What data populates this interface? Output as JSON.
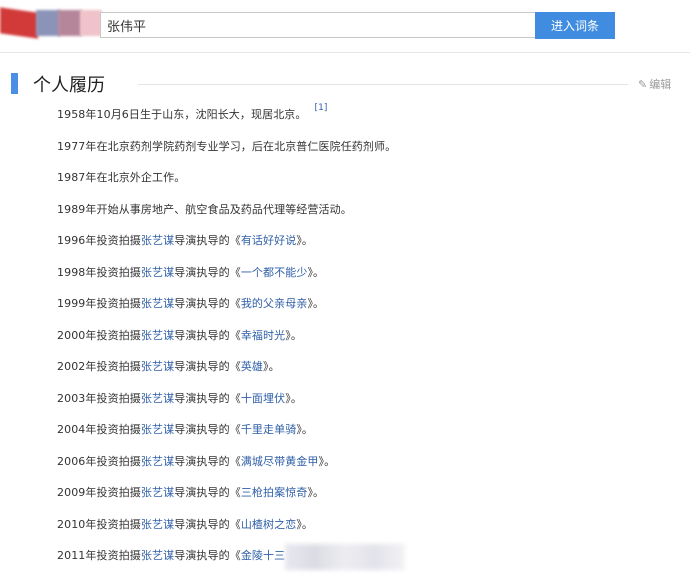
{
  "header": {
    "search_value": "张伟平",
    "search_button": "进入词条",
    "logo_colors": [
      "#d23a3a",
      "#8c93b8",
      "#b5869a",
      "#efc3c9"
    ]
  },
  "section": {
    "title": "个人履历",
    "edit_label": "编辑",
    "accent_color": "#4a8ee6"
  },
  "entries": [
    {
      "text": "1958年10月6日生于山东，沈阳长大，现居北京。",
      "ref": "[1]"
    },
    {
      "text": "1977年在北京药剂学院药剂专业学习，后在北京普仁医院任药剂师。"
    },
    {
      "text": "1987年在北京外企工作。"
    },
    {
      "text": "1989年开始从事房地产、航空食品及药品代理等经营活动。"
    },
    {
      "prefix": "1996年投资拍摄",
      "director": "张艺谋",
      "middle": "导演执导的《",
      "film": "有话好好说",
      "suffix": "》。"
    },
    {
      "prefix": "1998年投资拍摄",
      "director": "张艺谋",
      "middle": "导演执导的《",
      "film": "一个都不能少",
      "suffix": "》。"
    },
    {
      "prefix": "1999年投资拍摄",
      "director": "张艺谋",
      "middle": "导演执导的《",
      "film": "我的父亲母亲",
      "suffix": "》。"
    },
    {
      "prefix": "2000年投资拍摄",
      "director": "张艺谋",
      "middle": "导演执导的《",
      "film": "幸福时光",
      "suffix": "》。"
    },
    {
      "prefix": "2002年投资拍摄",
      "director": "张艺谋",
      "middle": "导演执导的《",
      "film": "英雄",
      "suffix": "》。"
    },
    {
      "prefix": "2003年投资拍摄",
      "director": "张艺谋",
      "middle": "导演执导的《",
      "film": "十面埋伏",
      "suffix": "》。"
    },
    {
      "prefix": "2004年投资拍摄",
      "director": "张艺谋",
      "middle": "导演执导的《",
      "film": "千里走单骑",
      "suffix": "》。"
    },
    {
      "prefix": "2006年投资拍摄",
      "director": "张艺谋",
      "middle": "导演执导的《",
      "film": "满城尽带黄金甲",
      "suffix": "》。"
    },
    {
      "prefix": "2009年投资拍摄",
      "director": "张艺谋",
      "middle": "导演执导的《",
      "film": "三枪拍案惊奇",
      "suffix": "》。"
    },
    {
      "prefix": "2010年投资拍摄",
      "director": "张艺谋",
      "middle": "导演执导的《",
      "film": "山楂树之恋",
      "suffix": "》。"
    },
    {
      "prefix": "2011年投资拍摄",
      "director": "张艺谋",
      "middle": "导演执导的《",
      "film": "金陵十三",
      "suffix": ""
    }
  ]
}
